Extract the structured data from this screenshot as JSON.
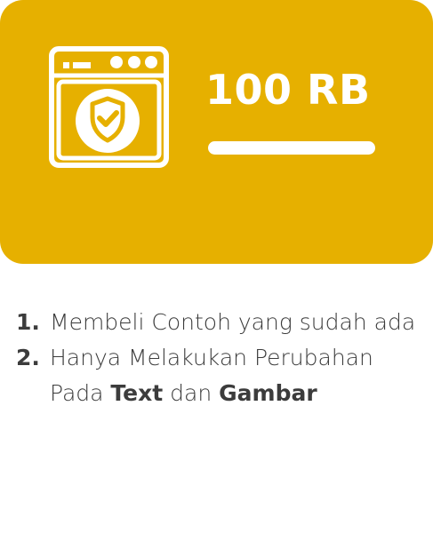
{
  "card": {
    "background": "#e6b000",
    "icon": "washing-machine-shield-icon",
    "price": "100 RB"
  },
  "terms": [
    {
      "number": "1.",
      "text": "Membeli Contoh yang sudah ada"
    },
    {
      "number": "2.",
      "text_before": "Hanya Melakukan Perubahan Pada ",
      "bold_1": "Text",
      "text_mid": " dan ",
      "bold_2": "Gambar"
    }
  ]
}
